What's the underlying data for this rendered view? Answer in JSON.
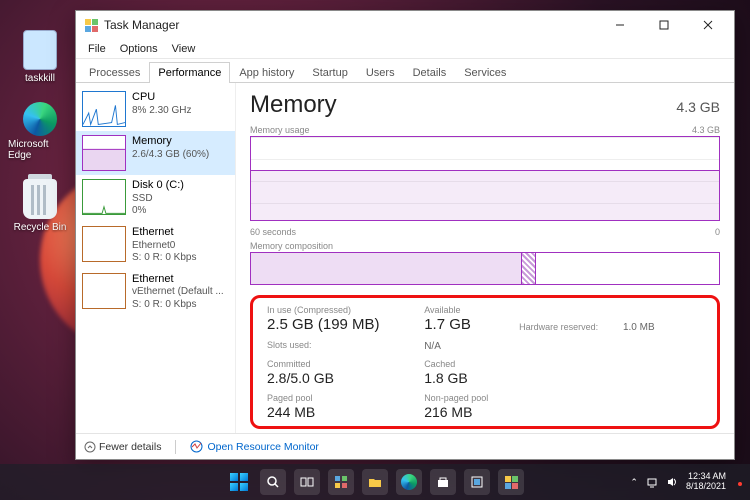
{
  "desktop": {
    "icons": [
      {
        "name": "taskkill",
        "kind": "txt"
      },
      {
        "name": "Microsoft Edge",
        "kind": "edge"
      },
      {
        "name": "Recycle Bin",
        "kind": "bin"
      }
    ]
  },
  "window": {
    "title": "Task Manager",
    "menu": [
      "File",
      "Options",
      "View"
    ],
    "tabs": [
      "Processes",
      "Performance",
      "App history",
      "Startup",
      "Users",
      "Details",
      "Services"
    ],
    "active_tab": 1
  },
  "sidebar": [
    {
      "name": "CPU",
      "sub1": "8%  2.30 GHz",
      "sub2": "",
      "kind": "cpu"
    },
    {
      "name": "Memory",
      "sub1": "2.6/4.3 GB (60%)",
      "sub2": "",
      "kind": "mem",
      "selected": true
    },
    {
      "name": "Disk 0 (C:)",
      "sub1": "SSD",
      "sub2": "0%",
      "kind": "disk"
    },
    {
      "name": "Ethernet",
      "sub1": "Ethernet0",
      "sub2": "S: 0  R: 0 Kbps",
      "kind": "eth"
    },
    {
      "name": "Ethernet",
      "sub1": "vEthernet (Default ...",
      "sub2": "S: 0  R: 0 Kbps",
      "kind": "eth"
    }
  ],
  "main": {
    "title": "Memory",
    "total": "4.3 GB",
    "usage_label_left": "Memory usage",
    "usage_label_right": "4.3 GB",
    "time_left": "60 seconds",
    "time_right": "0",
    "comp_label": "Memory composition",
    "stats": {
      "inuse_label": "In use (Compressed)",
      "inuse_val": "2.5 GB (199 MB)",
      "avail_label": "Available",
      "avail_val": "1.7 GB",
      "slots_label": "Slots used:",
      "slots_val": "N/A",
      "hw_label": "Hardware reserved:",
      "hw_val": "1.0 MB",
      "committed_label": "Committed",
      "committed_val": "2.8/5.0 GB",
      "cached_label": "Cached",
      "cached_val": "1.8 GB",
      "paged_label": "Paged pool",
      "paged_val": "244 MB",
      "nonpaged_label": "Non-paged pool",
      "nonpaged_val": "216 MB"
    }
  },
  "statusbar": {
    "fewer": "Fewer details",
    "resmon": "Open Resource Monitor"
  },
  "tray": {
    "time": "12:34 AM",
    "date": "8/18/2021"
  },
  "chart_data": {
    "type": "area",
    "title": "Memory usage",
    "ylabel": "GB",
    "ylim": [
      0,
      4.3
    ],
    "xrange_seconds": 60,
    "series": [
      {
        "name": "In use",
        "values": [
          2.6,
          2.6,
          2.6,
          2.55,
          2.55,
          2.55,
          2.55,
          2.55,
          2.55,
          2.55,
          2.6,
          2.6,
          2.6,
          2.6,
          2.6,
          2.6
        ]
      }
    ],
    "composition": {
      "total_gb": 4.3,
      "in_use_gb": 2.5,
      "modified_gb": 0.1,
      "standby_gb": 1.7,
      "free_gb": 0.0
    }
  }
}
